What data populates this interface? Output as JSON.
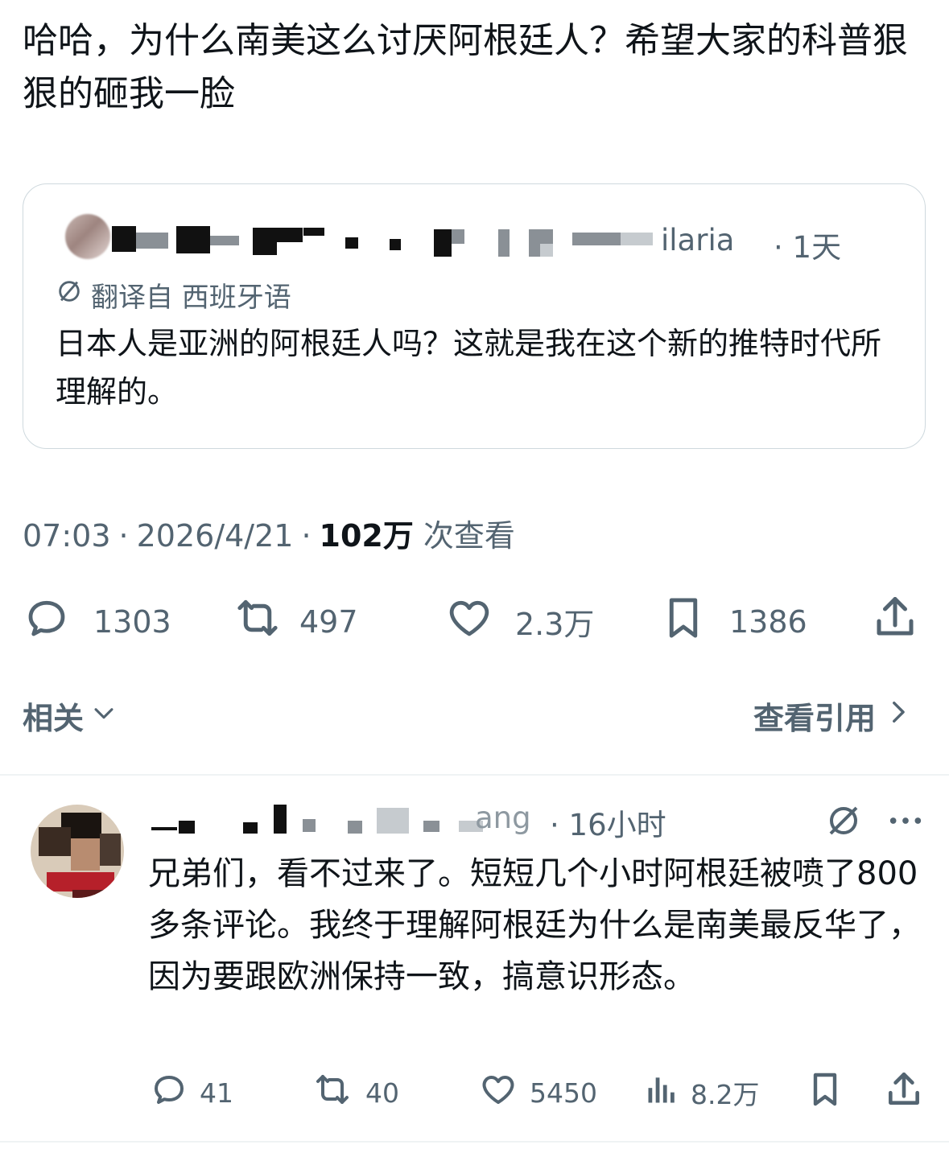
{
  "post": {
    "text": "哈哈，为什么南美这么讨厌阿根廷人？希望大家的科普狠狠的砸我一脸"
  },
  "quote": {
    "name_tail": "ilaria",
    "time": "· 1天",
    "translate_label": "翻译自 西班牙语",
    "text": "日本人是亚洲的阿根廷人吗？这就是我在这个新的推特时代所理解的。"
  },
  "meta": {
    "time": "07:03",
    "date": "2026/4/21",
    "sep": "·",
    "views": "102万",
    "views_label": "次查看"
  },
  "actions": {
    "replies": "1303",
    "reposts": "497",
    "likes": "2.3万",
    "bookmarks": "1386"
  },
  "related": {
    "label": "相关",
    "view_quotes": "查看引用"
  },
  "reply": {
    "name_tail": "ang",
    "time": "· 16小时",
    "text": "兄弟们，看不过来了。短短几个小时阿根廷被喷了800多条评论。我终于理解阿根廷为什么是南美最反华了，因为要跟欧洲保持一致，搞意识形态。",
    "replies": "41",
    "reposts": "40",
    "likes": "5450",
    "views": "8.2万"
  },
  "colors": {
    "text": "#0f1419",
    "secondary": "#536471",
    "border": "#cfd9de"
  }
}
